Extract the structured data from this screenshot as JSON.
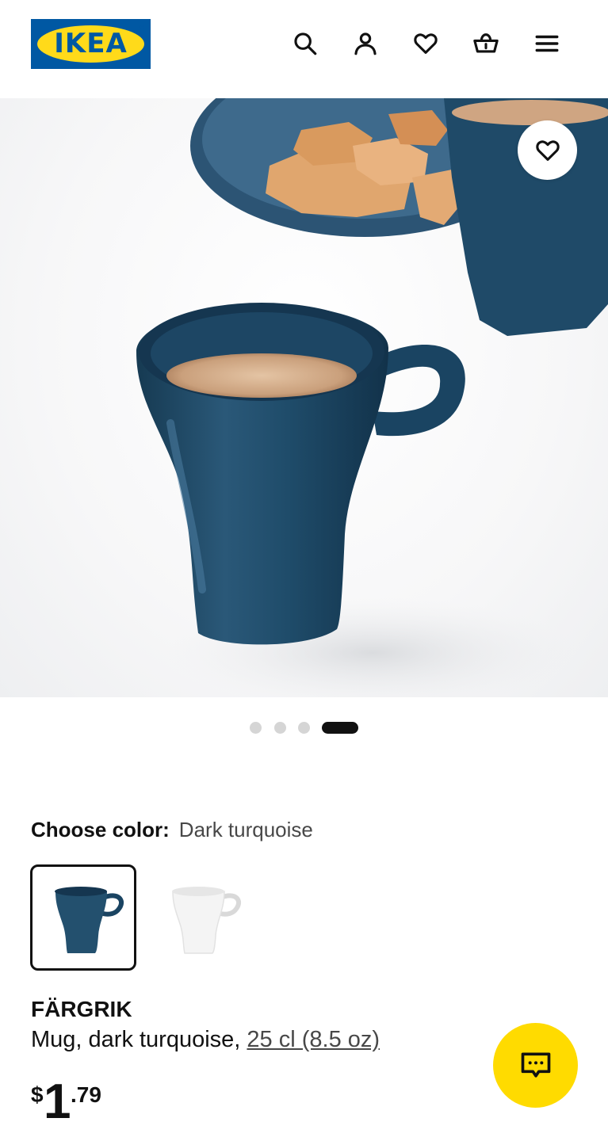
{
  "header": {
    "logo_text": "IKEA",
    "icons": [
      "search-icon",
      "account-icon",
      "heart-icon",
      "cart-icon",
      "menu-icon"
    ]
  },
  "gallery": {
    "image_count": 4,
    "active_index": 3
  },
  "color_picker": {
    "label": "Choose color:",
    "selected_value": "Dark turquoise",
    "options": [
      {
        "name": "dark turquoise",
        "color": "#1e4a66",
        "selected": true
      },
      {
        "name": "white",
        "color": "#f2f2f2",
        "selected": false
      }
    ]
  },
  "product": {
    "name": "FÄRGRIK",
    "description_prefix": "Mug, dark turquoise, ",
    "size_link": "25 cl (8.5 oz)",
    "price_currency": "$",
    "price_integer": "1",
    "price_decimal": ".79"
  },
  "colors": {
    "brand_blue": "#0058a3",
    "brand_yellow": "#ffda1a",
    "chat_yellow": "#ffdb00"
  }
}
